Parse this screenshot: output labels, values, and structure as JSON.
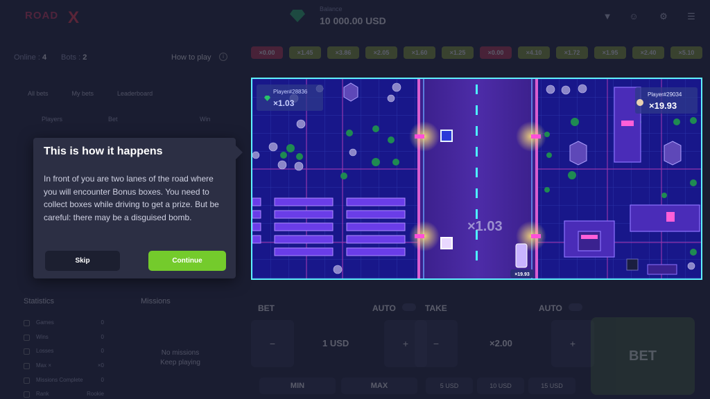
{
  "header": {
    "logo_line1": "ROAD",
    "logo_line2": "X",
    "balance_label": "Balance",
    "balance_value": "10 000.00 USD",
    "icons": [
      "dropdown-icon",
      "avatar-icon",
      "settings-icon",
      "menu-icon"
    ]
  },
  "left": {
    "online_label": "Online :",
    "online_value": "4",
    "bots_label": "Bots :",
    "bots_value": "2",
    "how_to_play": "How to play",
    "tabs": [
      "All bets",
      "My bets",
      "Leaderboard"
    ],
    "table_headers": [
      "Players",
      "Bet",
      "Win"
    ]
  },
  "popup": {
    "title": "This is how it happens",
    "body": "In front of you are two lanes of the road where you will encounter Bonus boxes. You need to collect boxes while driving to get a prize. But be careful: there may be a disguised bomb.",
    "skip_label": "Skip",
    "continue_label": "Continue"
  },
  "statistics": {
    "title": "Statistics",
    "rows": [
      {
        "label": "Games",
        "value": "0"
      },
      {
        "label": "Wins",
        "value": "0"
      },
      {
        "label": "Losses",
        "value": "0"
      },
      {
        "label": "Max ×",
        "value": "×0"
      },
      {
        "label": "Missions Complete",
        "value": "0"
      },
      {
        "label": "Rank",
        "value": "Rookie"
      }
    ]
  },
  "missions": {
    "title": "Missions",
    "empty_line1": "No missions",
    "empty_line2": "Keep playing"
  },
  "history": [
    {
      "value": "×0.00",
      "color": "#c0304a"
    },
    {
      "value": "×1.45",
      "color": "#8aa32a"
    },
    {
      "value": "×3.86",
      "color": "#8aa32a"
    },
    {
      "value": "×2.05",
      "color": "#8aa32a"
    },
    {
      "value": "×1.60",
      "color": "#8aa32a"
    },
    {
      "value": "×1.25",
      "color": "#8aa32a"
    },
    {
      "value": "×0.00",
      "color": "#c0304a"
    },
    {
      "value": "×4.10",
      "color": "#8aa32a"
    },
    {
      "value": "×1.72",
      "color": "#8aa32a"
    },
    {
      "value": "×1.95",
      "color": "#8aa32a"
    },
    {
      "value": "×2.40",
      "color": "#8aa32a"
    },
    {
      "value": "×5.10",
      "color": "#8aa32a"
    }
  ],
  "game": {
    "player_left": "Player#28836",
    "mult_left": "×1.03",
    "player_right": "Player#29034",
    "mult_right": "×19.93",
    "center_mult": "×1.03",
    "car_tag": "×19.93"
  },
  "controls": {
    "bet_label": "BET",
    "take_label": "TAKE",
    "auto_label": "AUTO",
    "minus": "−",
    "plus": "+",
    "bet_value": "1 USD",
    "take_value": "×2.00",
    "bet_button": "BET",
    "min_label": "MIN",
    "max_label": "MAX",
    "quick_bets": [
      "5 USD",
      "10 USD",
      "15 USD"
    ]
  }
}
